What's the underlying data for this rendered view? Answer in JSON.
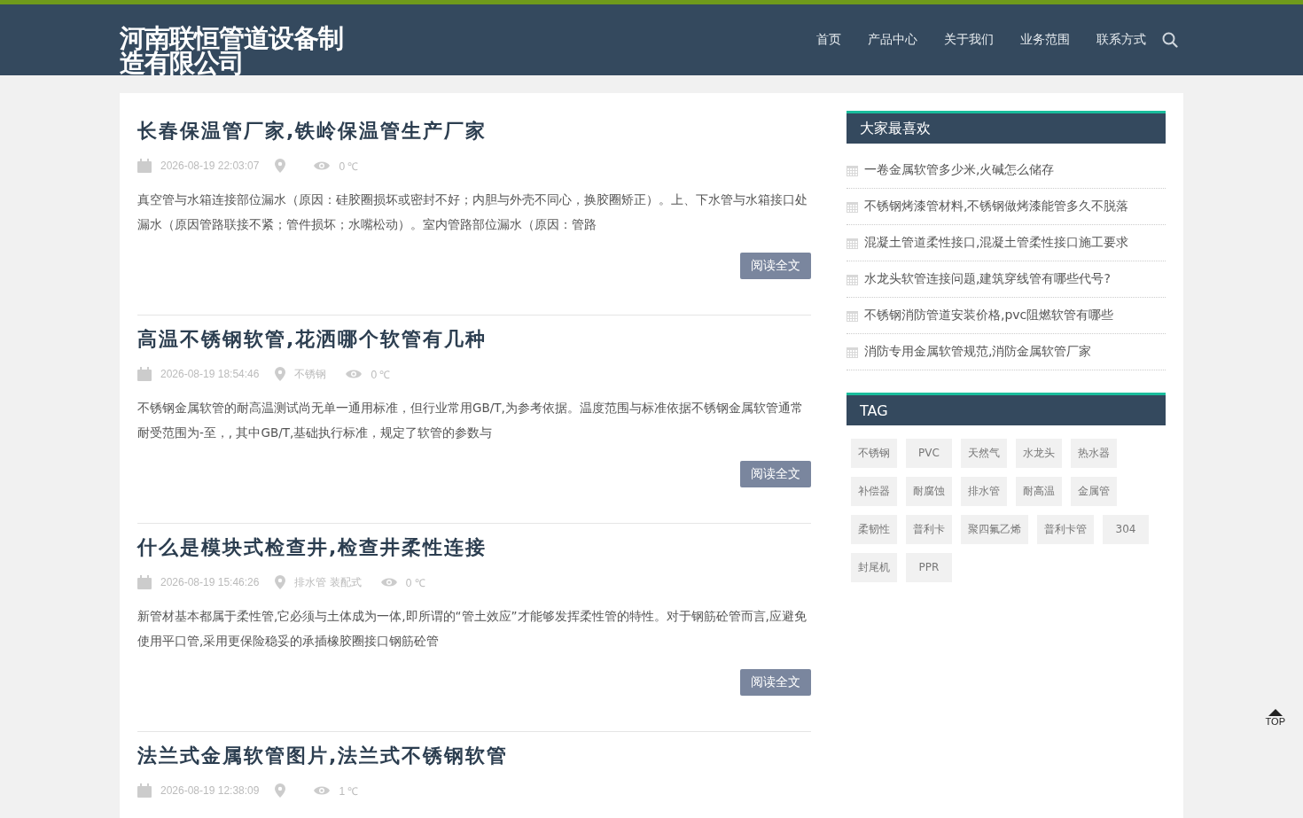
{
  "header": {
    "logo": "河南联恒管道设备制造有限公司",
    "nav": [
      {
        "label": "首页"
      },
      {
        "label": "产品中心"
      },
      {
        "label": "关于我们"
      },
      {
        "label": "业务范围"
      },
      {
        "label": "联系方式"
      }
    ]
  },
  "articles": [
    {
      "title": "长春保温管厂家,铁岭保温管生产厂家",
      "date": "2026-08-19 22:03:07",
      "views": "0 ℃",
      "excerpt": "真空管与水箱连接部位漏水（原因：硅胶圈损坏或密封不好；内胆与外壳不同心，换胶圈矫正）。上、下水管与水箱接口处漏水（原因管路联接不紧；管件损坏；水嘴松动）。室内管路部位漏水（原因：管路",
      "button": "阅读全文"
    },
    {
      "title": "高温不锈钢软管,花洒哪个软管有几种",
      "date": "2026-08-19 18:54:46",
      "location": "不锈钢",
      "views": "0 ℃",
      "excerpt": "不锈钢金属软管的耐高温测试尚无单一通用标准，但行业常用GB/T,为参考依据。温度范围与标准依据不锈钢金属软管通常耐受范围为-至，, 其中GB/T,基础执行标准，规定了软管的参数与",
      "button": "阅读全文"
    },
    {
      "title": "什么是模块式检查井,检查井柔性连接",
      "date": "2026-08-19 15:46:26",
      "location": "排水管 装配式",
      "views": "0 ℃",
      "excerpt": "新管材基本都属于柔性管,它必须与土体成为一体,即所谓的“管土效应”才能够发挥柔性管的特性。对于钢筋砼管而言,应避免使用平口管,采用更保险稳妥的承插橡胶圈接口钢筋砼管",
      "button": "阅读全文"
    },
    {
      "title": "法兰式金属软管图片,法兰式不锈钢软管",
      "date": "2026-08-19 12:38:09",
      "views": "1 ℃"
    }
  ],
  "sidebar": {
    "popular": {
      "title": "大家最喜欢",
      "items": [
        "一卷金属软管多少米,火碱怎么储存",
        "不锈钢烤漆管材料,不锈钢做烤漆能管多久不脱落",
        "混凝土管道柔性接口,混凝土管柔性接口施工要求",
        "水龙头软管连接问题,建筑穿线管有哪些代号?",
        "不锈钢消防管道安装价格,pvc阻燃软管有哪些",
        "消防专用金属软管规范,消防金属软管厂家"
      ]
    },
    "tags": {
      "title": "TAG",
      "items": [
        "不锈钢",
        "PVC",
        "天然气",
        "水龙头",
        "热水器",
        "补偿器",
        "耐腐蚀",
        "排水管",
        "耐高温",
        "金属管",
        "柔韧性",
        "普利卡",
        "聚四氟乙烯",
        "普利卡管",
        "304",
        "封尾机",
        "PPR"
      ]
    }
  },
  "back_to_top": "TOP"
}
